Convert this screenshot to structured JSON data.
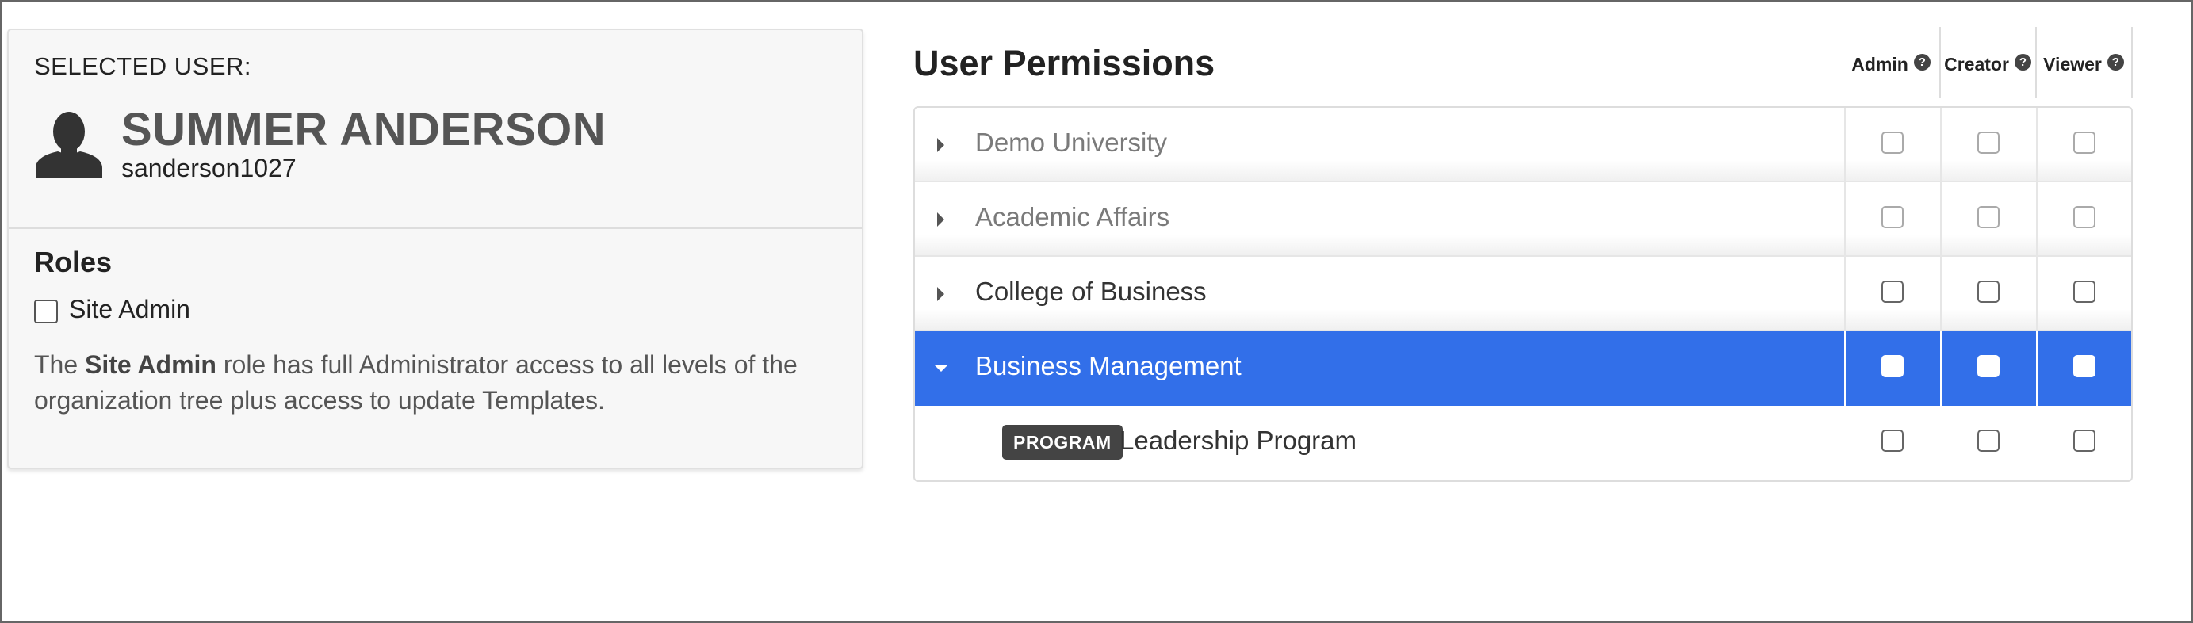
{
  "user": {
    "selected_label": "SELECTED USER:",
    "name": "SUMMER ANDERSON",
    "username": "sanderson1027",
    "avatar_icon": "user-silhouette-icon"
  },
  "roles": {
    "title": "Roles",
    "site_admin_label": "Site Admin",
    "site_admin_checked": false,
    "description_prefix": "The ",
    "description_bold": "Site Admin",
    "description_rest": " role has full Administrator access to all levels of the organization tree plus access to update Templates."
  },
  "permissions": {
    "title": "User Permissions",
    "columns": [
      {
        "label": "Admin",
        "help_icon": "question-circle-icon"
      },
      {
        "label": "Creator",
        "help_icon": "question-circle-icon"
      },
      {
        "label": "Viewer",
        "help_icon": "question-circle-icon"
      }
    ],
    "rows": [
      {
        "name": "Demo University",
        "state": "collapsed",
        "style": "muted",
        "admin": false,
        "creator": false,
        "viewer": false
      },
      {
        "name": "Academic Affairs",
        "state": "collapsed",
        "style": "muted",
        "admin": false,
        "creator": false,
        "viewer": false
      },
      {
        "name": "College of Business",
        "state": "collapsed",
        "style": "normal",
        "admin": false,
        "creator": false,
        "viewer": false
      },
      {
        "name": "Business Management",
        "state": "expanded",
        "style": "selected",
        "admin": false,
        "creator": false,
        "viewer": false
      },
      {
        "name": "Leadership Program",
        "badge": "PROGRAM",
        "style": "child",
        "admin": false,
        "creator": false,
        "viewer": false
      }
    ]
  },
  "colors": {
    "selected_row": "#326fe9",
    "badge": "#444444"
  }
}
